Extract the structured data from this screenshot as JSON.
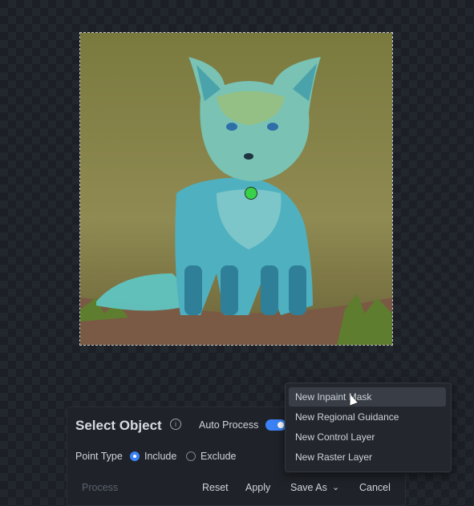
{
  "panel": {
    "title": "Select Object",
    "auto_process_label": "Auto Process",
    "auto_process_on": true,
    "point_type_label": "Point Type",
    "radio_include": "Include",
    "radio_exclude": "Exclude",
    "selected_point_type": "Include"
  },
  "buttons": {
    "process": "Process",
    "reset": "Reset",
    "apply": "Apply",
    "save_as": "Save As",
    "cancel": "Cancel"
  },
  "dropdown": {
    "items": [
      "New Inpaint Mask",
      "New Regional Guidance",
      "New Control Layer",
      "New Raster Layer"
    ],
    "hovered_index": 0
  },
  "colors": {
    "accent": "#3b82f6",
    "point_marker": "#3ad14a",
    "panel_bg": "#1f2228"
  }
}
